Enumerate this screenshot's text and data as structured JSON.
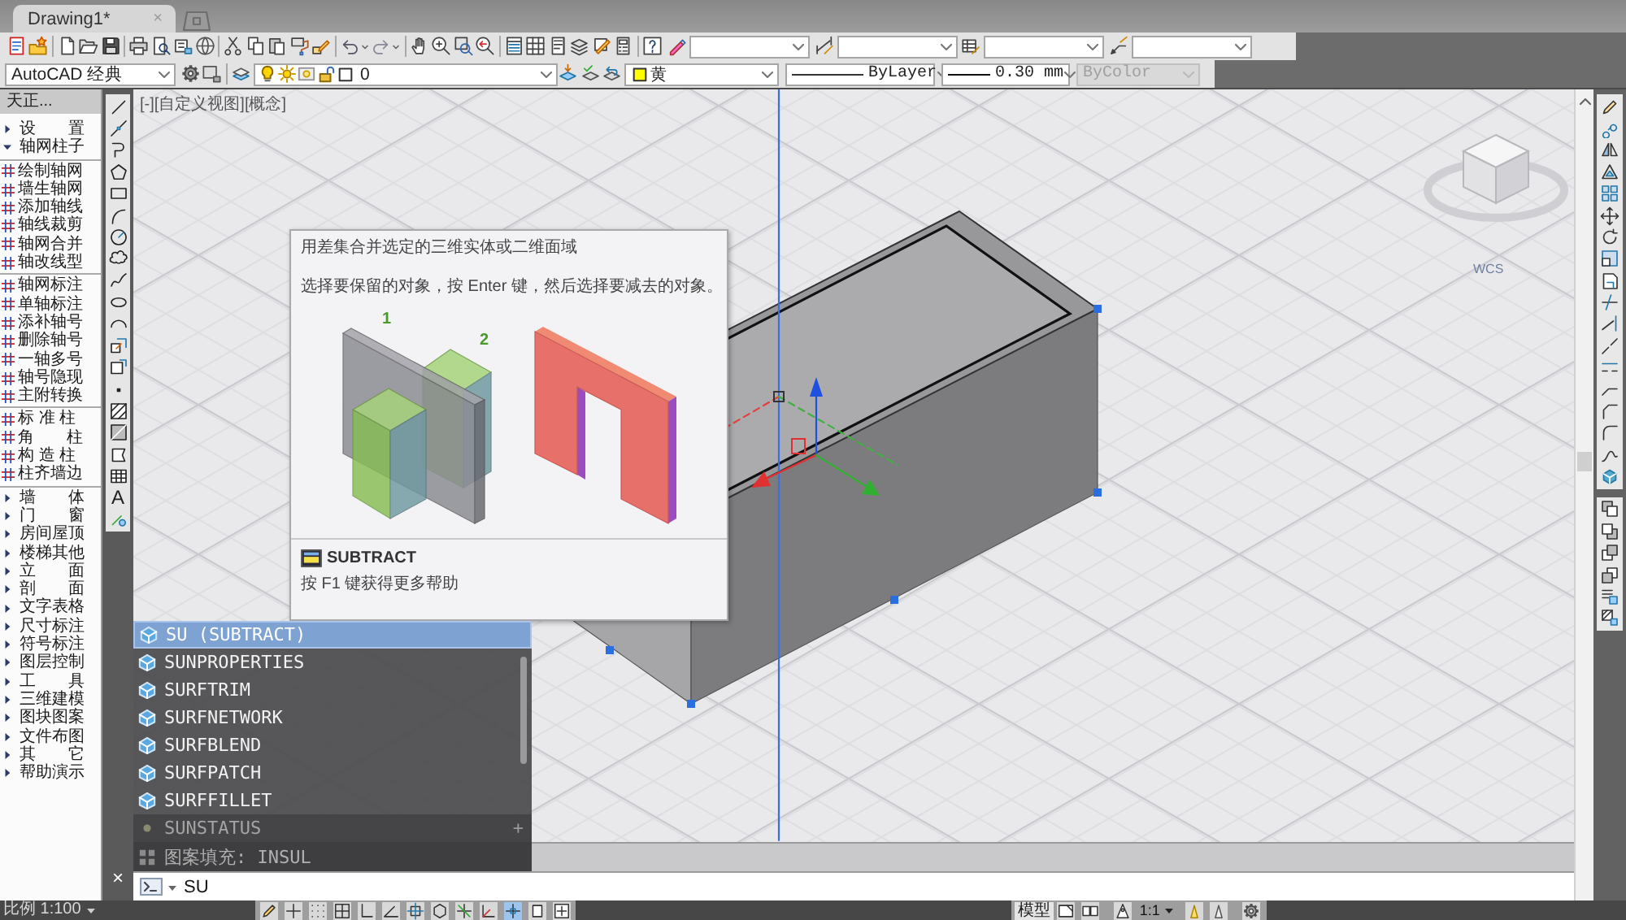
{
  "tabs": [
    {
      "label": "Drawing1*",
      "selected": true,
      "close": "×"
    }
  ],
  "workspace": {
    "value": "AutoCAD 经典"
  },
  "layer": {
    "value": "0",
    "on": true,
    "frozen": false,
    "locked": false
  },
  "properties": [
    {
      "kind": "color",
      "value": "黄"
    },
    {
      "kind": "linetype",
      "value": "ByLayer"
    },
    {
      "kind": "lineweight",
      "value": "0.30 mm"
    },
    {
      "kind": "plotstyle",
      "value": "ByColor",
      "disabled": true
    }
  ],
  "tianzheng_menu": {
    "title": "天正...",
    "items": [
      {
        "label": "设　　置",
        "expanded": false
      },
      {
        "label": "轴网柱子",
        "expanded": true,
        "children": [
          {
            "label": "绘制轴网",
            "kind": "command"
          },
          {
            "label": "墙生轴网",
            "kind": "command"
          },
          {
            "label": "添加轴线",
            "kind": "command"
          },
          {
            "label": "轴线裁剪",
            "kind": "command"
          },
          {
            "label": "轴网合并",
            "kind": "command"
          },
          {
            "label": "轴改线型",
            "kind": "command"
          },
          {
            "kind": "divider"
          },
          {
            "label": "轴网标注",
            "kind": "command"
          },
          {
            "label": "单轴标注",
            "kind": "command"
          },
          {
            "label": "添补轴号",
            "kind": "command"
          },
          {
            "label": "删除轴号",
            "kind": "command"
          },
          {
            "label": "一轴多号",
            "kind": "command"
          },
          {
            "label": "轴号隐现",
            "kind": "command"
          },
          {
            "label": "主附转换",
            "kind": "command"
          },
          {
            "kind": "divider"
          },
          {
            "label": "标 准 柱",
            "kind": "command"
          },
          {
            "label": "角　　柱",
            "kind": "command"
          },
          {
            "label": "构 造 柱",
            "kind": "command"
          },
          {
            "label": "柱齐墙边",
            "kind": "command"
          }
        ]
      },
      {
        "label": "墙　　体",
        "expanded": false
      },
      {
        "label": "门　　窗",
        "expanded": false
      },
      {
        "label": "房间屋顶",
        "expanded": false
      },
      {
        "label": "楼梯其他",
        "expanded": false
      },
      {
        "label": "立　　面",
        "expanded": false
      },
      {
        "label": "剖　　面",
        "expanded": false
      },
      {
        "label": "文字表格",
        "expanded": false
      },
      {
        "label": "尺寸标注",
        "expanded": false
      },
      {
        "label": "符号标注",
        "expanded": false
      },
      {
        "label": "图层控制",
        "expanded": false
      },
      {
        "label": "工　　具",
        "expanded": false
      },
      {
        "label": "三维建模",
        "expanded": false
      },
      {
        "label": "图块图案",
        "expanded": false
      },
      {
        "label": "文件布图",
        "expanded": false
      },
      {
        "label": "其　　它",
        "expanded": false
      },
      {
        "label": "帮助演示",
        "expanded": false
      }
    ]
  },
  "draw_toolbar": {
    "text_tool": "A"
  },
  "viewport": {
    "label": "[-][自定义视图][概念]",
    "ucs": "WCS"
  },
  "tooltip": {
    "description": "用差集合并选定的三维实体或二维面域",
    "instruction": "选择要保留的对象，按 Enter 键，然后选择要减去的对象。",
    "callouts": [
      "1",
      "2"
    ],
    "command": "SUBTRACT",
    "help": "按 F1 键获得更多帮助"
  },
  "autocomplete": [
    {
      "label": "SU (SUBTRACT)",
      "kind": "command",
      "selected": true
    },
    {
      "label": "SUNPROPERTIES",
      "kind": "command",
      "selected": false
    },
    {
      "label": "SURFTRIM",
      "kind": "command",
      "selected": false
    },
    {
      "label": "SURFNETWORK",
      "kind": "command",
      "selected": false
    },
    {
      "label": "SURFBLEND",
      "kind": "command",
      "selected": false
    },
    {
      "label": "SURFPATCH",
      "kind": "command",
      "selected": false
    },
    {
      "label": "SURFFILLET",
      "kind": "command",
      "selected": false
    },
    {
      "label": "SUNSTATUS",
      "kind": "variable",
      "selected": false,
      "trailing": "+"
    }
  ],
  "command_line": {
    "close": "×",
    "history": "图案填充: INSUL",
    "input": "SU"
  },
  "status_bar": {
    "scale": "比例 1:100",
    "toggles": [
      {
        "on": false
      },
      {
        "on": false
      },
      {
        "on": false
      },
      {
        "on": false
      },
      {
        "on": false
      },
      {
        "on": false
      },
      {
        "on": false
      },
      {
        "on": false
      },
      {
        "on": false
      },
      {
        "on": false
      },
      {
        "on": true
      },
      {
        "on": false
      },
      {
        "on": false
      }
    ],
    "space": "模型",
    "annotation_scale": "1:1"
  }
}
